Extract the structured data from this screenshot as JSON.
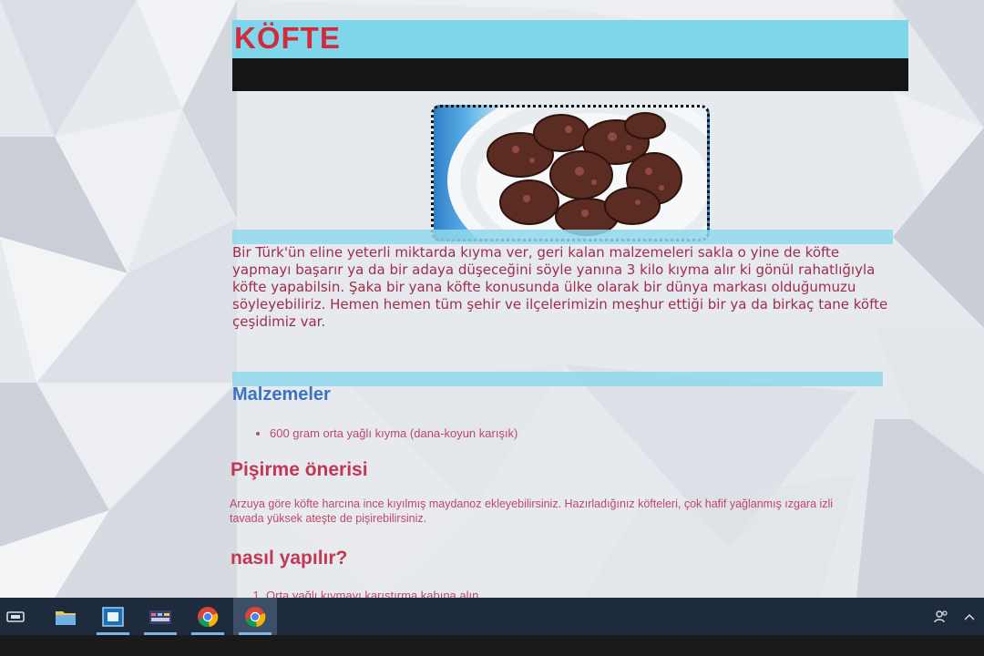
{
  "page": {
    "title": "KÖFTE",
    "image_alt": "Köfte tabağı",
    "intro": "Bir Türk'ün eline yeterli miktarda kıyma ver, geri kalan malzemeleri sakla o yine de köfte yapmayı başarır ya da bir adaya düşeceğini söyle yanına 3 kilo kıyma alır ki gönül rahatlığıyla köfte yapabilsin. Şaka bir yana köfte konusunda ülke olarak bir dünya markası olduğumuzu söyleyebiliriz. Hemen hemen tüm şehir ve ilçelerimizin meşhur ettiği bir ya da birkaç tane köfte çeşidimiz var.",
    "ingredients_heading": "Malzemeler",
    "ingredients": [
      "600 gram orta yağlı kıyma (dana-koyun karışık)"
    ],
    "tip_heading": "Pişirme önerisi",
    "tip_text": "Arzuya göre köfte harcına ince kıyılmış maydanoz ekleyebilirsiniz. Hazırladığınız köfteleri, çok hafif yağlanmış ızgara izli tavada yüksek ateşte de pişirebilirsiniz.",
    "steps_heading": "nasıl yapılır?",
    "steps": [
      "Orta yağlı kıymayı karıştırma kabına alın."
    ]
  },
  "taskbar": {
    "items": [
      {
        "name": "task-view-icon",
        "active": false
      },
      {
        "name": "file-explorer-icon",
        "active": false
      },
      {
        "name": "app-window-icon",
        "active": false
      },
      {
        "name": "media-app-icon",
        "active": false
      },
      {
        "name": "chrome-icon",
        "active": false
      },
      {
        "name": "chrome-icon",
        "active": true
      }
    ],
    "tray": [
      "people-icon",
      "chevron-up-icon"
    ]
  },
  "colors": {
    "title_red": "#d42b3c",
    "band_cyan": "#7fd6ea",
    "heading_blue": "#3b73c4",
    "heading_red": "#c43753",
    "text_maroon": "#a12d4a",
    "taskbar": "#1e2b3d"
  }
}
